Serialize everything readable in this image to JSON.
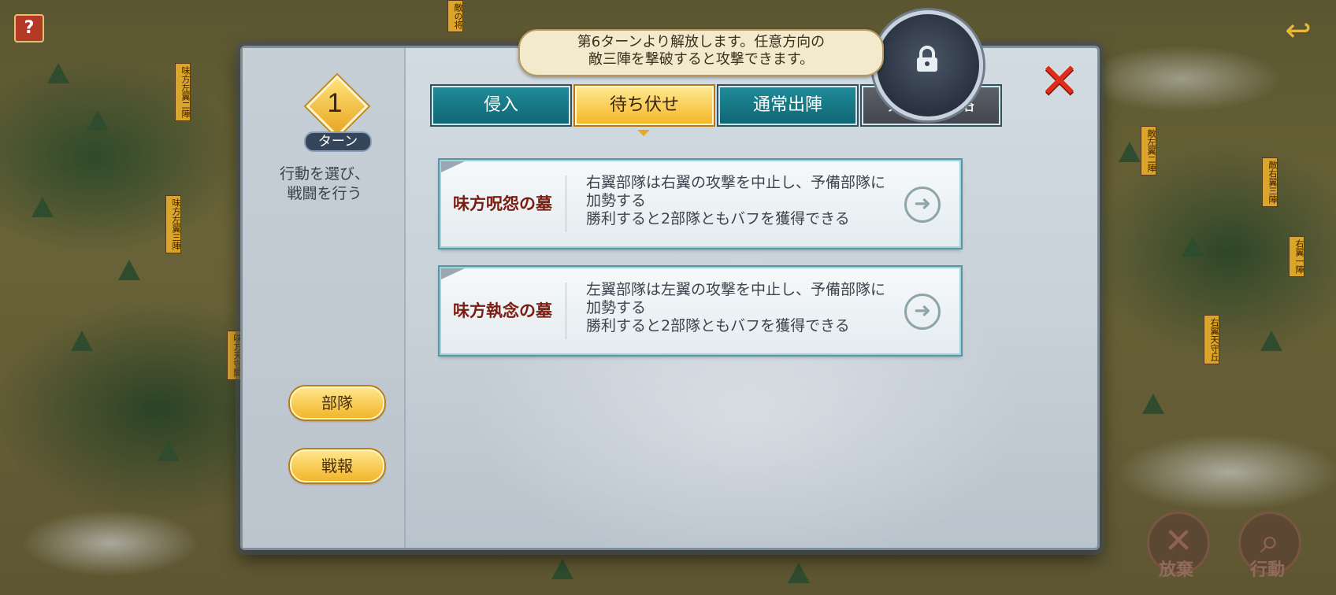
{
  "map": {
    "help_label": "?",
    "flags": [
      "味方天守",
      "右翼一陣",
      "味方左翼二陣",
      "敵右翼三陣",
      "敵左翼二陣",
      "味方左翼三陣",
      "味方天守閣",
      "右翼天守丘",
      "敵の将"
    ],
    "corner_buttons": [
      {
        "label": "放棄",
        "icon": "close-icon"
      },
      {
        "label": "行動",
        "icon": "magnifier-icon"
      }
    ]
  },
  "panel": {
    "tooltip": [
      "第6ターンより解放します。任意方向の",
      "敵三陣を撃破すると攻撃できます。"
    ],
    "turn": {
      "number": "1",
      "label": "ターン"
    },
    "side_description": [
      "行動を選び、",
      "戦闘を行う"
    ],
    "side_buttons": [
      "部隊",
      "戦報"
    ],
    "tabs": [
      {
        "label": "侵入",
        "state": "normal"
      },
      {
        "label": "待ち伏せ",
        "state": "active"
      },
      {
        "label": "通常出陣",
        "state": "normal"
      },
      {
        "label": "天守閣攻略",
        "state": "locked"
      }
    ],
    "cards": [
      {
        "title": "味方呪怨の墓",
        "lines": [
          "右翼部隊は右翼の攻撃を中止し、予備部隊に",
          "加勢する",
          "勝利すると2部隊ともバフを獲得できる"
        ]
      },
      {
        "title": "味方執念の墓",
        "lines": [
          "左翼部隊は左翼の攻撃を中止し、予備部隊に",
          "加勢する",
          "勝利すると2部隊ともバフを獲得できる"
        ]
      }
    ]
  },
  "colors": {
    "accent_gold": "#f4b72a",
    "tab_teal": "#1f8a98",
    "close_red": "#e02c1c",
    "card_title": "#7a1c10"
  }
}
